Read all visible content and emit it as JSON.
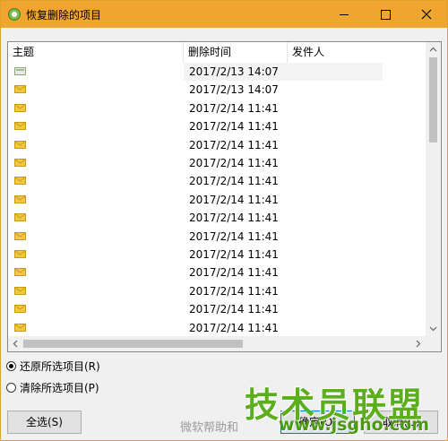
{
  "window": {
    "title": "恢复删除的项目"
  },
  "list": {
    "columns": [
      "主题",
      "删除时间",
      "发件人"
    ],
    "rows": [
      {
        "subject": "",
        "deleted": "2017/2/13 14:07",
        "sender": "",
        "selected": true,
        "icon": "calendar-item-icon"
      },
      {
        "subject": "",
        "deleted": "2017/2/13 14:07",
        "sender": "",
        "icon": "envelope-icon"
      },
      {
        "subject": "",
        "deleted": "2017/2/14 11:41",
        "sender": "",
        "icon": "envelope-icon"
      },
      {
        "subject": "",
        "deleted": "2017/2/14 11:41",
        "sender": "",
        "icon": "envelope-icon"
      },
      {
        "subject": "",
        "deleted": "2017/2/14 11:41",
        "sender": "",
        "icon": "envelope-icon"
      },
      {
        "subject": "",
        "deleted": "2017/2/14 11:41",
        "sender": "",
        "icon": "envelope-icon"
      },
      {
        "subject": "",
        "deleted": "2017/2/14 11:41",
        "sender": "",
        "icon": "envelope-icon"
      },
      {
        "subject": "",
        "deleted": "2017/2/14 11:41",
        "sender": "",
        "icon": "envelope-icon"
      },
      {
        "subject": "",
        "deleted": "2017/2/14 11:41",
        "sender": "",
        "icon": "envelope-icon"
      },
      {
        "subject": "",
        "deleted": "2017/2/14 11:41",
        "sender": "",
        "icon": "envelope-icon"
      },
      {
        "subject": "",
        "deleted": "2017/2/14 11:41",
        "sender": "",
        "icon": "envelope-icon"
      },
      {
        "subject": "",
        "deleted": "2017/2/14 11:41",
        "sender": "",
        "icon": "envelope-icon"
      },
      {
        "subject": "",
        "deleted": "2017/2/14 11:41",
        "sender": "",
        "icon": "envelope-icon"
      },
      {
        "subject": "",
        "deleted": "2017/2/14 11:41",
        "sender": "",
        "icon": "envelope-icon"
      },
      {
        "subject": "",
        "deleted": "2017/2/14 11:41",
        "sender": "",
        "icon": "envelope-icon"
      }
    ]
  },
  "options": {
    "restore_label": "还原所选项目(R)",
    "restore_checked": true,
    "purge_label": "清除所选项目(P)",
    "purge_checked": false
  },
  "buttons": {
    "select_all": "全选(S)",
    "ok": "确定(O)",
    "cancel": "取消(C)"
  },
  "watermark": {
    "caption": "微软帮助和",
    "logo": "技术员联盟",
    "url": "www.jsgho.com"
  },
  "colors": {
    "titlebar": "#f0a531",
    "envelope": "#f2c744",
    "watermark": "#5cae1d"
  }
}
